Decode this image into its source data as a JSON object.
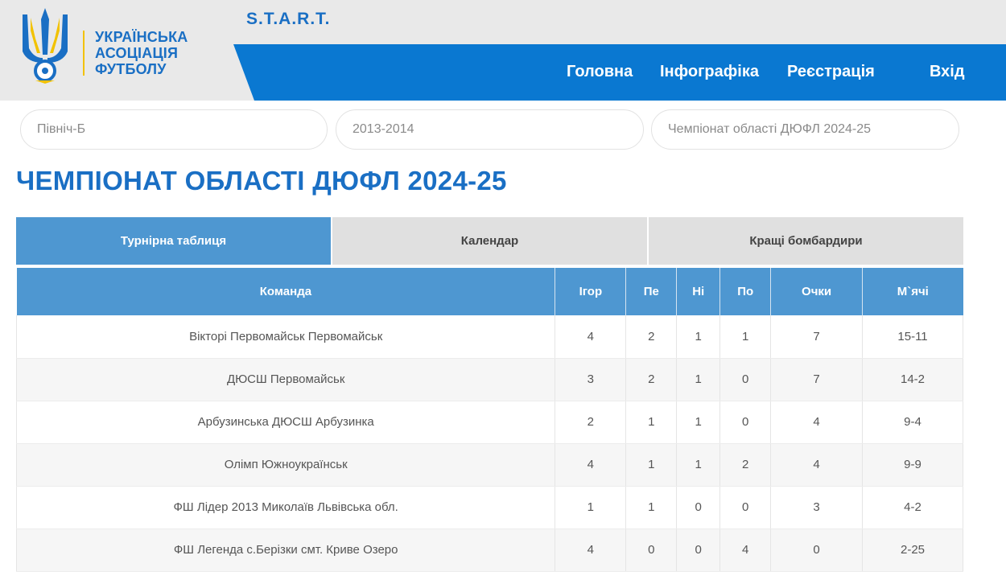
{
  "header": {
    "logo_lines": [
      "УКРАЇНСЬКА",
      "АСОЦІАЦІЯ",
      "ФУТБОЛУ"
    ],
    "brand": "S.T.A.R.T.",
    "nav": [
      "Головна",
      "Інфографіка",
      "Реєстрація",
      "Вхід"
    ],
    "colors": {
      "primary": "#0a78d1",
      "accent": "#f2c200",
      "tab_active": "#4e97d1"
    }
  },
  "filters": [
    "Північ-Б",
    "2013-2014",
    "Чемпіонат області ДЮФЛ 2024-25"
  ],
  "page_title": "ЧЕМПІОНАТ ОБЛАСТІ ДЮФЛ 2024-25",
  "tabs": [
    "Турнірна таблиця",
    "Календар",
    "Кращі бомбардири"
  ],
  "active_tab": 0,
  "table": {
    "columns": [
      "Команда",
      "Ігор",
      "Пе",
      "Ні",
      "По",
      "Очки",
      "М`ячі"
    ],
    "rows": [
      [
        "Вікторі Первомайськ Первомайськ",
        "4",
        "2",
        "1",
        "1",
        "7",
        "15-11"
      ],
      [
        "ДЮСШ Первомайськ",
        "3",
        "2",
        "1",
        "0",
        "7",
        "14-2"
      ],
      [
        "Арбузинська ДЮСШ Арбузинка",
        "2",
        "1",
        "1",
        "0",
        "4",
        "9-4"
      ],
      [
        "Олімп Южноукраїнськ",
        "4",
        "1",
        "1",
        "2",
        "4",
        "9-9"
      ],
      [
        "ФШ Лідер 2013 Миколаїв Львівська обл.",
        "1",
        "1",
        "0",
        "0",
        "3",
        "4-2"
      ],
      [
        "ФШ Легенда с.Берізки смт. Криве Озеро",
        "4",
        "0",
        "0",
        "4",
        "0",
        "2-25"
      ]
    ]
  }
}
